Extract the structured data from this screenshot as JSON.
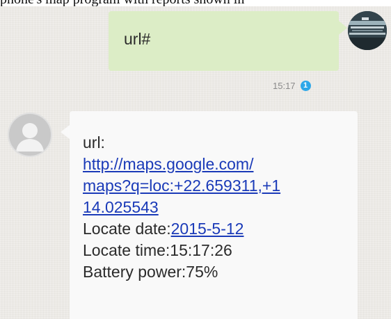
{
  "top_fragment": "phone's map program with reports shown in",
  "colors": {
    "outgoing_bubble": "#dcedc6",
    "incoming_bubble": "#f9f9f9",
    "link": "#1a3ab8",
    "badge": "#2ea7e8"
  },
  "outgoing": {
    "text": "url#",
    "time": "15:17",
    "sim_badge": "1"
  },
  "incoming": {
    "label": "url:",
    "url_lines": [
      "http://maps.google.com/",
      "maps?q=loc:+22.659311,+1",
      "14.025543"
    ],
    "date_label": "Locate date:",
    "date_value": "2015-5-12",
    "time_label": "Locate time:",
    "time_value": "15:17:26",
    "battery_label": "Battery power:",
    "battery_value": "75%"
  },
  "icons": {
    "contact_avatar": "default-person-icon",
    "self_avatar": "user-photo",
    "sim": "sim-1-badge"
  }
}
